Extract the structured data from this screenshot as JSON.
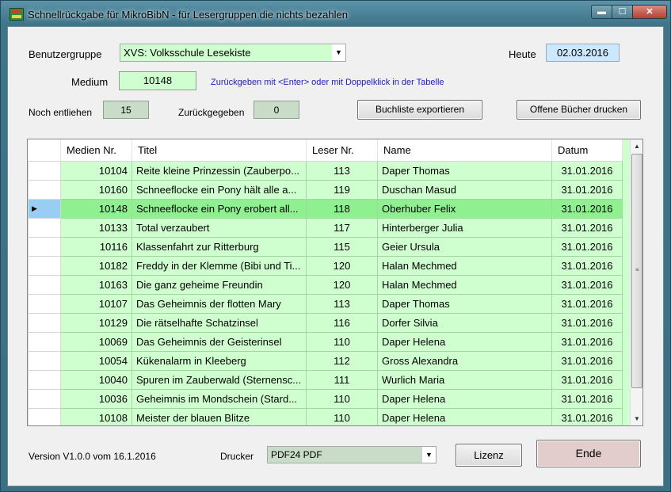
{
  "window": {
    "title": "Schnellrückgabe für MikroBibN - für Lesergruppen  die nichts bezahlen",
    "min_glyph": "▬",
    "max_glyph": "☐",
    "close_glyph": "✕"
  },
  "form": {
    "benutzergruppe_label": "Benutzergruppe",
    "benutzergruppe_value": "XVS: Volksschule Lesekiste",
    "heute_label": "Heute",
    "heute_value": "02.03.2016",
    "medium_label": "Medium",
    "medium_value": "10148",
    "hint": "Zurückgeben mit <Enter> oder mit Doppelklick in der Tabelle",
    "noch_label": "Noch entliehen",
    "noch_value": "15",
    "zurueck_label": "Zurückgegeben",
    "zurueck_value": "0",
    "export_button": "Buchliste exportieren",
    "print_open_button": "Offene Bücher drucken"
  },
  "table": {
    "columns": [
      "Medien Nr.",
      "Titel",
      "Leser Nr.",
      "Name",
      "Datum"
    ],
    "selected_row_index": 2,
    "selected_marker": "▶",
    "rows": [
      [
        "10104",
        "Reite kleine Prinzessin (Zauberpo...",
        "113",
        "Daper Thomas",
        "31.01.2016"
      ],
      [
        "10160",
        "Schneeflocke ein Pony hält alle a...",
        "119",
        "Duschan Masud",
        "31.01.2016"
      ],
      [
        "10148",
        "Schneeflocke ein Pony erobert all...",
        "118",
        "Oberhuber Felix",
        "31.01.2016"
      ],
      [
        "10133",
        "Total verzaubert",
        "117",
        "Hinterberger Julia",
        "31.01.2016"
      ],
      [
        "10116",
        "Klassenfahrt zur Ritterburg",
        "115",
        "Geier Ursula",
        "31.01.2016"
      ],
      [
        "10182",
        "Freddy in der Klemme (Bibi und Ti...",
        "120",
        "Halan Mechmed",
        "31.01.2016"
      ],
      [
        "10163",
        "Die ganz geheime Freundin",
        "120",
        "Halan Mechmed",
        "31.01.2016"
      ],
      [
        "10107",
        "Das Geheimnis der flotten Mary",
        "113",
        "Daper Thomas",
        "31.01.2016"
      ],
      [
        "10129",
        "Die rätselhafte Schatzinsel",
        "116",
        "Dorfer Silvia",
        "31.01.2016"
      ],
      [
        "10069",
        "Das Geheimnis der Geisterinsel",
        "110",
        "Daper Helena",
        "31.01.2016"
      ],
      [
        "10054",
        "Kükenalarm in Kleeberg",
        "112",
        "Gross Alexandra",
        "31.01.2016"
      ],
      [
        "10040",
        "Spuren im Zauberwald (Sternensc...",
        "111",
        "Wurlich Maria",
        "31.01.2016"
      ],
      [
        "10036",
        "Geheimnis im Mondschein (Stard...",
        "110",
        "Daper Helena",
        "31.01.2016"
      ],
      [
        "10108",
        "Meister der blauen Blitze",
        "110",
        "Daper Helena",
        "31.01.2016"
      ]
    ]
  },
  "footer": {
    "version": "Version V1.0.0 vom 16.1.2016",
    "drucker_label": "Drucker",
    "drucker_value": "PDF24 PDF",
    "lizenz_button": "Lizenz",
    "ende_button": "Ende"
  },
  "colors": {
    "row_background": "#cfffcf",
    "selected_row_background": "#8ef08e",
    "row_header_selected": "#99cdf4",
    "date_field_background": "#cce8ff",
    "ende_button_background": "#e3cccc",
    "hint_text": "#2020c0"
  }
}
